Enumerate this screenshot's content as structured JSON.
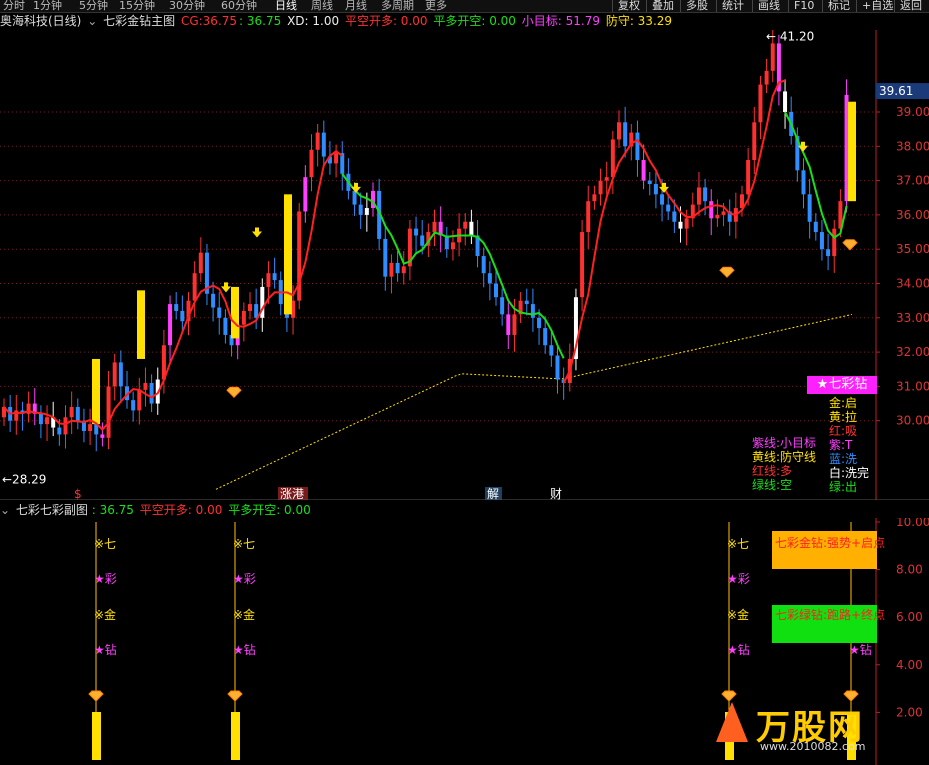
{
  "colors": {
    "up_candle": "#ff3030",
    "down_candle": "#2f8dff",
    "pink": "#ff40ff",
    "yellow": "#ffe000",
    "green": "#18e018",
    "red_line": "#ff2020",
    "grid": "#7a1a1a",
    "axis": "#c02020"
  },
  "topbar": {
    "tabs": [
      "分时",
      "1分钟",
      "5分钟",
      "15分钟",
      "30分钟",
      "60分钟",
      "日线",
      "周线",
      "月线",
      "多周期",
      "更多"
    ],
    "active_tab": "日线",
    "buttons": [
      "复权",
      "叠加",
      "多股",
      "统计",
      "画线",
      "F10",
      "标记",
      "+自选",
      "返回"
    ]
  },
  "main_header": {
    "stock": "奥海科技(日线)",
    "indicator": "七彩金钻主图",
    "cg_label": "CG:",
    "cg_val1": "36.75",
    "cg_val2": ": 36.75",
    "xd": "XD: 1.00",
    "pkd": "平空开多: 0.00",
    "pdk": "平多开空: 0.00",
    "target": "小目标: 51.79",
    "defense": "防守: 33.29"
  },
  "main_chart": {
    "y_ticks": [
      "39.00",
      "38.00",
      "37.00",
      "36.00",
      "35.00",
      "34.00",
      "33.00",
      "32.00",
      "31.00",
      "30.00"
    ],
    "current_price": "39.61",
    "high_label": "41.20",
    "low_label": "28.29",
    "low_arrow": "←",
    "high_arrow": "←",
    "news_markers": [
      "$",
      "涨港",
      "解",
      "财"
    ]
  },
  "star_badge": "★七彩钻",
  "legend_left": [
    {
      "text": "紫线:小目标",
      "color": "#ff40ff"
    },
    {
      "text": "黄线:防守线",
      "color": "#ffe000"
    },
    {
      "text": "红线:多",
      "color": "#ff3030"
    },
    {
      "text": "绿线:空",
      "color": "#18e018"
    }
  ],
  "legend_right": [
    {
      "text": "金:启",
      "color": "#ffe000"
    },
    {
      "text": "黄:拉",
      "color": "#ffe000"
    },
    {
      "text": "红:吸",
      "color": "#ff3030"
    },
    {
      "text": "紫:T",
      "color": "#ff40ff"
    },
    {
      "text": "蓝:洗",
      "color": "#2f8dff"
    },
    {
      "text": "白:洗完",
      "color": "#ffffff"
    },
    {
      "text": "绿:出",
      "color": "#18e018"
    }
  ],
  "sub_header": {
    "indicator": "七彩七彩副图",
    "val": ": 36.75",
    "pkd": "平空开多: 0.00",
    "pdk": "平多开空: 0.00"
  },
  "sub_chart": {
    "y_ticks": [
      "10.00",
      "8.00",
      "6.00",
      "4.00",
      "2.00"
    ],
    "signal_labels": [
      "※七",
      "★彩",
      "※金",
      "★钻"
    ]
  },
  "notices": {
    "gold": "七彩金钻:强势+启点",
    "green": "七彩绿钻:跑路+终点"
  },
  "logo": {
    "brand": "万股网",
    "url": "www.2010082.com"
  }
}
